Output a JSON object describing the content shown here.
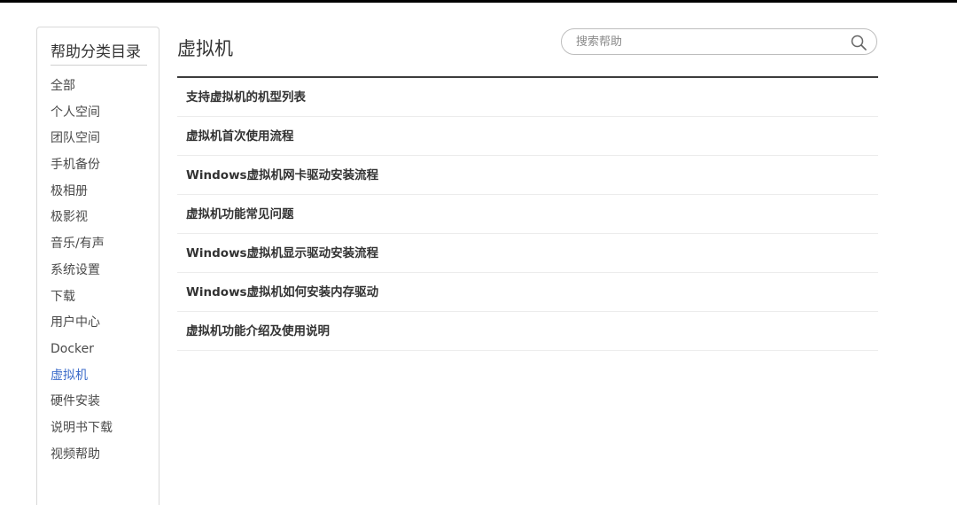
{
  "sidebar": {
    "title": "帮助分类目录",
    "items": [
      {
        "label": "全部",
        "active": false
      },
      {
        "label": "个人空间",
        "active": false
      },
      {
        "label": "团队空间",
        "active": false
      },
      {
        "label": "手机备份",
        "active": false
      },
      {
        "label": "极相册",
        "active": false
      },
      {
        "label": "极影视",
        "active": false
      },
      {
        "label": "音乐/有声",
        "active": false
      },
      {
        "label": "系统设置",
        "active": false
      },
      {
        "label": "下载",
        "active": false
      },
      {
        "label": "用户中心",
        "active": false
      },
      {
        "label": "Docker",
        "active": false
      },
      {
        "label": "虚拟机",
        "active": true
      },
      {
        "label": "硬件安装",
        "active": false
      },
      {
        "label": "说明书下载",
        "active": false
      },
      {
        "label": "视频帮助",
        "active": false
      }
    ]
  },
  "main": {
    "title": "虚拟机",
    "search": {
      "placeholder": "搜索帮助",
      "value": ""
    },
    "articles": [
      "支持虚拟机的机型列表",
      "虚拟机首次使用流程",
      "Windows虚拟机网卡驱动安装流程",
      "虚拟机功能常见问题",
      "Windows虚拟机显示驱动安装流程",
      "Windows虚拟机如何安装内存驱动",
      "虚拟机功能介绍及使用说明"
    ]
  },
  "colors": {
    "active_link": "#3b6bc9",
    "text": "#333333",
    "top_border": "#000000"
  }
}
